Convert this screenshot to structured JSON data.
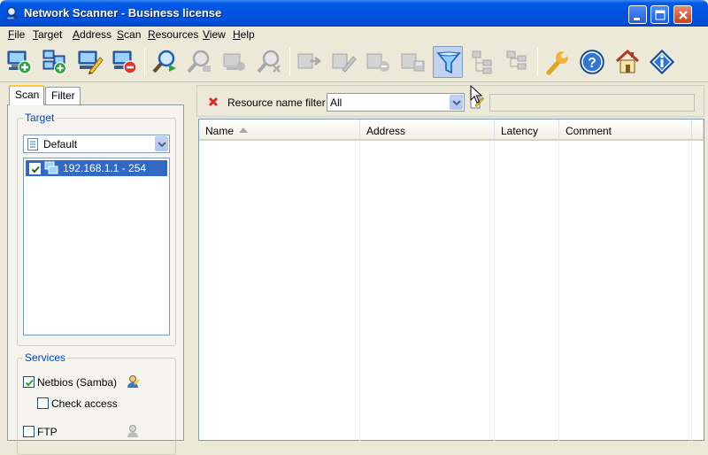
{
  "window": {
    "title": "Network Scanner - Business license"
  },
  "menu": [
    {
      "mnemonic": "F",
      "rest": "ile"
    },
    {
      "mnemonic": "T",
      "rest": "arget"
    },
    {
      "mnemonic": "A",
      "rest": "ddress"
    },
    {
      "mnemonic": "S",
      "rest": "can"
    },
    {
      "mnemonic": "R",
      "rest": "esources"
    },
    {
      "mnemonic": "V",
      "rest": "iew"
    },
    {
      "mnemonic": "H",
      "rest": "elp"
    }
  ],
  "toolbar": {
    "icons": [
      "add-computer-icon",
      "add-network-icon",
      "edit-computer-icon",
      "remove-computer-icon",
      "scan-search-icon",
      "scan-search-disabled-icon",
      "scan-next-disabled-icon",
      "stop-scan-disabled-icon",
      "export-disabled-icon",
      "edit-resource-disabled-icon",
      "remove-resource-disabled-icon",
      "save-disabled-icon",
      "filter-icon",
      "tree-collapse-disabled-icon",
      "tree-expand-disabled-icon",
      "options-wrench-icon",
      "help-icon",
      "home-icon",
      "about-icon"
    ],
    "filter_pressed": true
  },
  "left_panel": {
    "tabs": [
      "Scan",
      "Filter"
    ],
    "active_tab": "Scan",
    "target": {
      "label": "Target",
      "profile": "Default",
      "items": [
        {
          "label": "192.168.1.1 - 254",
          "checked": true,
          "selected": true
        }
      ]
    },
    "services": {
      "label": "Services",
      "netbios": {
        "label": "Netbios (Samba)",
        "checked": true
      },
      "check_access": {
        "label": "Check access",
        "checked": false
      },
      "ftp": {
        "label": "FTP",
        "checked": false
      }
    }
  },
  "right_panel": {
    "filter": {
      "label": "Resource name filter",
      "selected": "All",
      "text": ""
    },
    "columns": [
      {
        "label": "Name",
        "sorted": "ascending"
      },
      {
        "label": "Address"
      },
      {
        "label": "Latency"
      },
      {
        "label": "Comment"
      }
    ],
    "rows": []
  },
  "colors": {
    "titlebar": "#0053e1",
    "selection": "#316ac5",
    "group_label": "#0046d5",
    "accent_tab": "#ffc83c"
  }
}
